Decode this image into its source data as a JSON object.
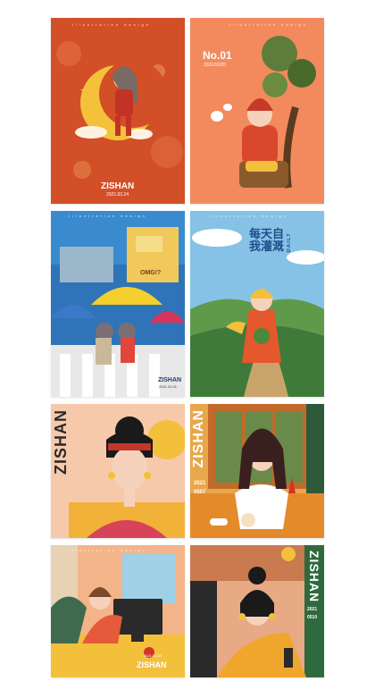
{
  "cards": [
    {
      "brand": "ZISHAN",
      "date": "2021.03.24",
      "top_text": "illustration design"
    },
    {
      "issue": "No.01",
      "date": "2021/10/20",
      "top_text": "illustration design"
    },
    {
      "sign": "OMG!?",
      "brand": "ZISHAN",
      "date": "2021.04.01",
      "top_text": "illustration design"
    },
    {
      "headline": "每天自我灌溉",
      "sub": "DAILY",
      "top_text": "illustration design"
    },
    {
      "brand": "ZISHAN"
    },
    {
      "brand": "ZISHAN",
      "year": "2021",
      "date": "0507"
    },
    {
      "brand": "ZISHAN",
      "date": "2021.03.24",
      "top_text": "illustration design"
    },
    {
      "brand": "ZISHAN",
      "year": "2021",
      "date": "0510"
    }
  ],
  "colors": {
    "orange_red": "#d95a2b",
    "peach": "#f08a5d",
    "sky": "#7ec4e8",
    "teal": "#3d6b5e"
  }
}
